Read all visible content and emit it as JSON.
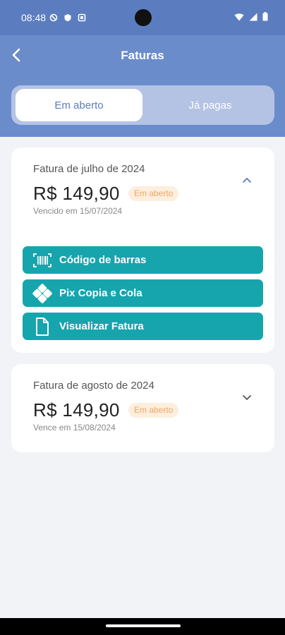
{
  "status_bar": {
    "time": "08:48"
  },
  "header": {
    "title": "Faturas"
  },
  "tabs": [
    {
      "label": "Em aberto",
      "active": true
    },
    {
      "label": "Já pagas",
      "active": false
    }
  ],
  "invoices": [
    {
      "title": "Fatura de julho de 2024",
      "amount": "R$ 149,90",
      "status": "Em aberto",
      "due": "Vencido em 15/07/2024",
      "expanded": true,
      "actions": [
        {
          "label": "Código de barras",
          "icon": "barcode-icon"
        },
        {
          "label": "Pix Copia e Cola",
          "icon": "pix-icon"
        },
        {
          "label": "Visualizar Fatura",
          "icon": "document-icon"
        }
      ]
    },
    {
      "title": "Fatura de agosto de 2024",
      "amount": "R$ 149,90",
      "status": "Em aberto",
      "due": "Vence em 15/08/2024",
      "expanded": false
    }
  ],
  "colors": {
    "header": "#6b8ccb",
    "status_bar": "#5b7dbf",
    "action_button": "#16a5ad",
    "badge_bg": "#fdeedd",
    "badge_text": "#eea866",
    "background": "#f1f3f6"
  }
}
